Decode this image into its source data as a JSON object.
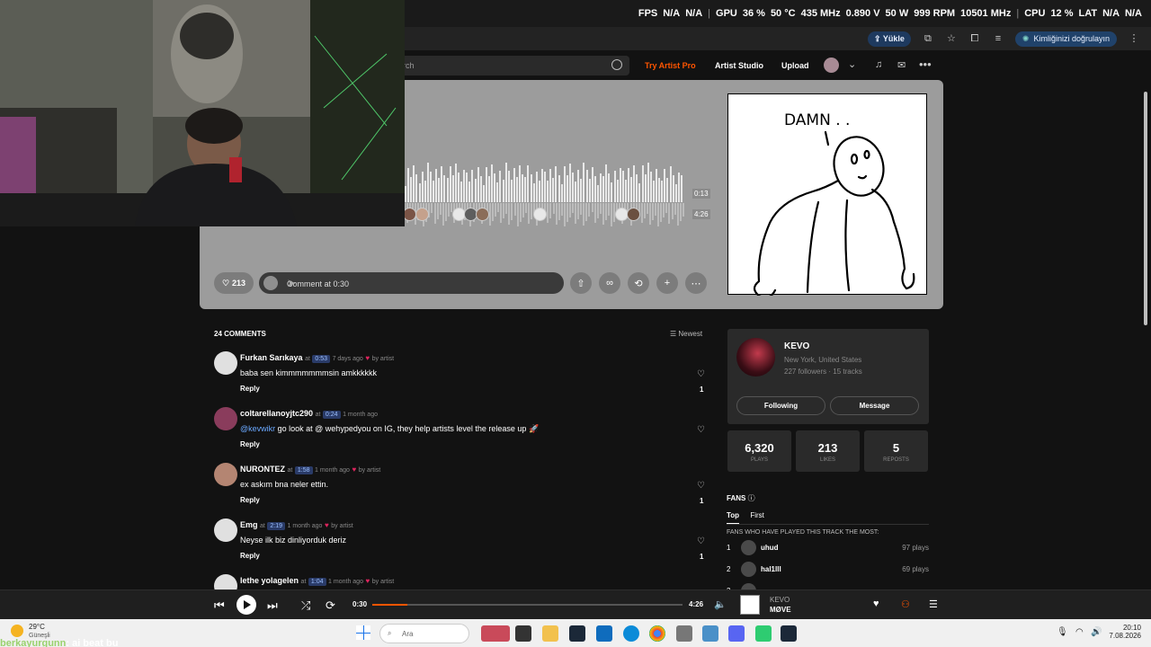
{
  "osd": {
    "fps_label": "FPS",
    "fps1": "N/A",
    "fps2": "N/A",
    "gpu_label": "GPU",
    "gpu_load": "36 %",
    "gpu_temp": "50 °C",
    "gpu_clock": "435 MHz",
    "gpu_volt": "0.890 V",
    "gpu_power": "50 W",
    "gpu_fan": "999 RPM",
    "gpu_mem": "10501 MHz",
    "cpu_label": "CPU",
    "cpu_load": "12 %",
    "lat_label": "LAT",
    "lat1": "N/A",
    "lat2": "N/A"
  },
  "browser": {
    "upload_label": "Yükle",
    "identity_label": "Kimliğinizi doğrulayın"
  },
  "header": {
    "search_placeholder": "rch",
    "try_pro": "Try Artist Pro",
    "artist_studio": "Artist Studio",
    "upload": "Upload"
  },
  "hero": {
    "time_current": "0:13",
    "time_total": "4:26",
    "like_count": "213",
    "comment_placeholder": "Comment at 0:30",
    "artwork_caption": "DAMN . ."
  },
  "comments": {
    "count_label": "24 COMMENTS",
    "sort_label": "Newest",
    "items": [
      {
        "user": "Furkan Sarıkaya",
        "at": "at",
        "ts": "0:53",
        "ago": "7 days ago",
        "by": "by artist",
        "text": "baba sen kimmmmmmmsin amkkkkkk",
        "reply": "Reply",
        "likes": "1"
      },
      {
        "user": "coltarellanoyjtc290",
        "at": "at",
        "ts": "0:24",
        "ago": "1 month ago",
        "by": "",
        "mention": "@kevwikr",
        "text": " go look at @ wehypedyou on IG, they help artists level the release up 🚀",
        "reply": "Reply",
        "likes": ""
      },
      {
        "user": "NURONTEZ",
        "at": "at",
        "ts": "1:58",
        "ago": "1 month ago",
        "by": "by artist",
        "text": "ex askım bna neler ettin.",
        "reply": "Reply",
        "likes": "1"
      },
      {
        "user": "Emg",
        "at": "at",
        "ts": "2:19",
        "ago": "1 month ago",
        "by": "by artist",
        "text": "Neyse ilk biz dinliyorduk deriz",
        "reply": "Reply",
        "likes": "1"
      },
      {
        "user": "lethe yolagelen",
        "at": "at",
        "ts": "1:04",
        "ago": "1 month ago",
        "by": "by artist",
        "text": "",
        "reply": "",
        "likes": ""
      }
    ]
  },
  "artist": {
    "name": "KEVO",
    "location": "New York, United States",
    "stats": "227 followers · 15 tracks",
    "following_btn": "Following",
    "message_btn": "Message"
  },
  "stats": {
    "plays_value": "6,320",
    "plays_label": "PLAYS",
    "likes_value": "213",
    "likes_label": "LIKES",
    "reposts_value": "5",
    "reposts_label": "REPOSTS"
  },
  "fans": {
    "title": "FANS",
    "tab_top": "Top",
    "tab_first": "First",
    "note": "FANS WHO HAVE PLAYED THIS TRACK THE MOST:",
    "rows": [
      {
        "rank": "1",
        "name": "uhud",
        "plays": "97 plays"
      },
      {
        "rank": "2",
        "name": "hal1lll",
        "plays": "69 plays"
      },
      {
        "rank": "3",
        "name": "",
        "plays": ""
      }
    ]
  },
  "player": {
    "elapsed": "0:30",
    "duration": "4:26",
    "progress_fraction": 0.113,
    "artist": "KEVO",
    "title": "MØVE"
  },
  "taskbar": {
    "weather_temp": "29°C",
    "weather_desc": "Güneşli",
    "search_placeholder": "Ara",
    "time": "20:10",
    "date": "7.08.2026"
  },
  "chat": {
    "username": "berkayurgunn",
    "message": ": ai beat bu"
  },
  "colors": {
    "accent": "#ff5500",
    "hero_bg": "#9c9c9c",
    "page_bg": "#121212",
    "highlight_blue": "#9cc0ff"
  }
}
